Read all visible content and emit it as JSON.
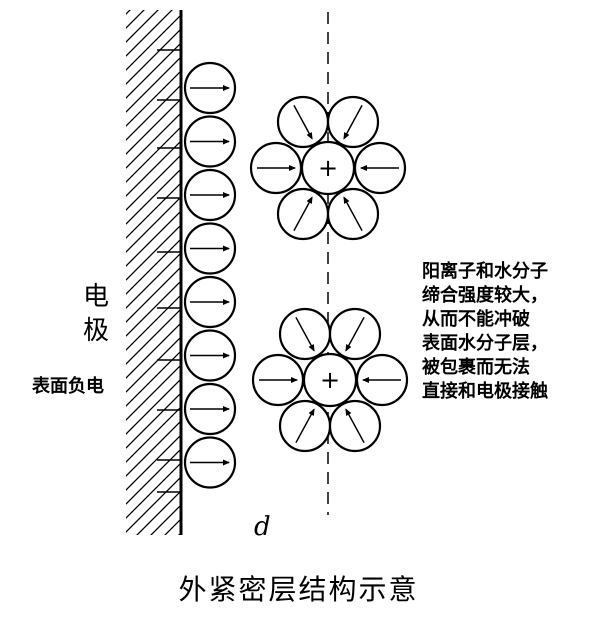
{
  "labels": {
    "electrode_char1": "电",
    "electrode_char2": "极",
    "surface_charge": "表面负电",
    "distance_symbol": "d",
    "cation_sign": "+",
    "caption": "外紧密层结构示意"
  },
  "note_lines": [
    "阳离子和水分子",
    "缔合强度较大，",
    "从而不能冲破",
    "表面水分子层，",
    "被包裹而无法",
    "直接和电极接触"
  ],
  "adsorbed_water_count": 8,
  "hydrated_cation_count": 2,
  "waters_per_cation": 6
}
